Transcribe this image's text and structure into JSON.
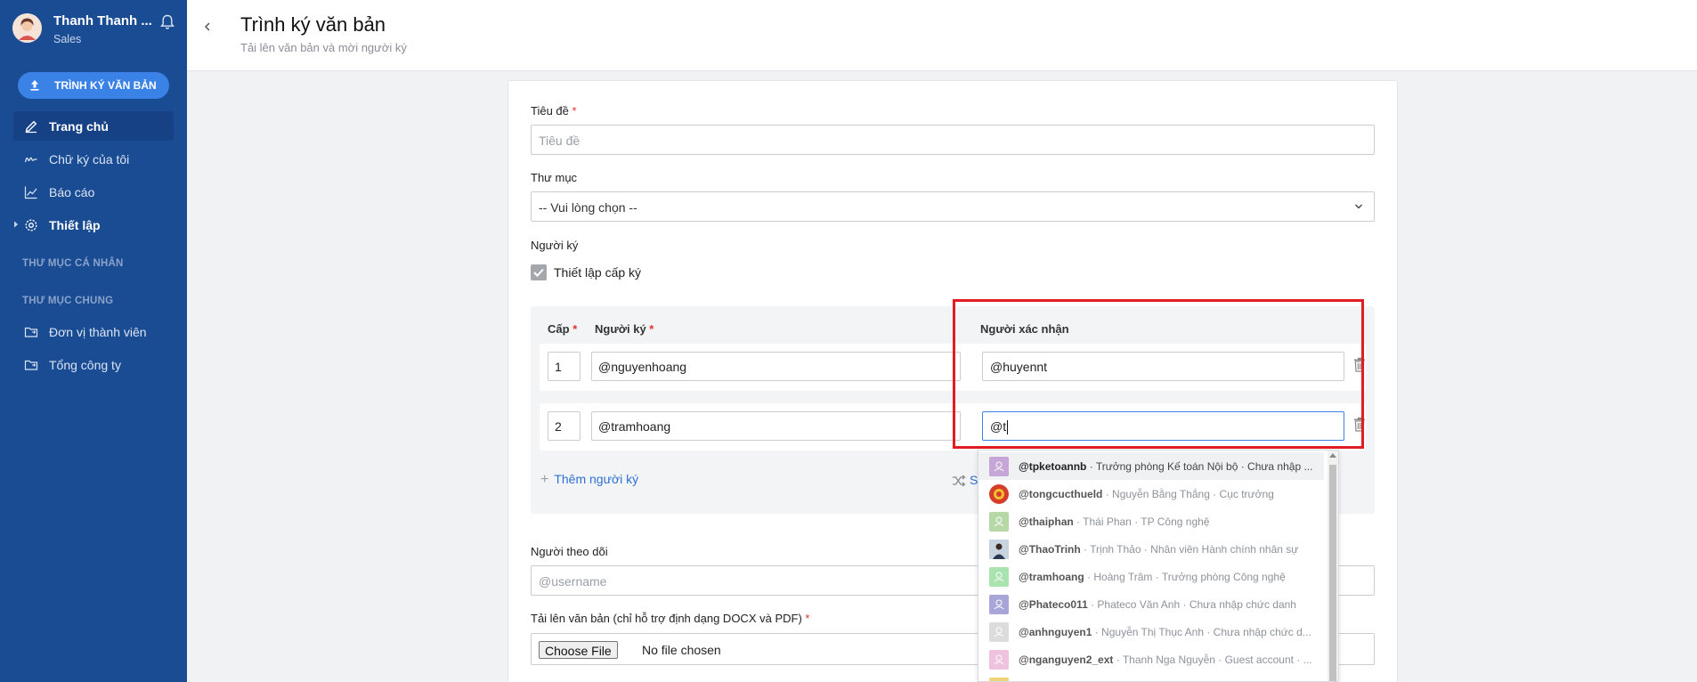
{
  "sidebar": {
    "user_name": "Thanh Thanh ...",
    "user_role": "Sales",
    "primary_button": "TRÌNH KÝ VĂN BẢN",
    "nav": [
      {
        "label": "Trang chủ",
        "icon": "pen-icon",
        "active": true
      },
      {
        "label": "Chữ ký của tôi",
        "icon": "signature-icon",
        "active": false
      },
      {
        "label": "Báo cáo",
        "icon": "chart-line-icon",
        "active": false
      },
      {
        "label": "Thiết lập",
        "icon": "gear-icon",
        "active": false
      }
    ],
    "section_personal": "THƯ MỤC CÁ NHÂN",
    "section_shared": "THƯ MỤC CHUNG",
    "folders": [
      {
        "label": "Đơn vị thành viên",
        "icon": "folder-icon"
      },
      {
        "label": "Tổng công ty",
        "icon": "folder-icon"
      }
    ]
  },
  "header": {
    "title": "Trình ký văn bản",
    "subtitle": "Tải lên văn bản và mời người ký"
  },
  "form": {
    "title_label": "Tiêu đề",
    "title_placeholder": "Tiêu đề",
    "folder_label": "Thư mục",
    "folder_value": "-- Vui lòng chọn --",
    "signers_label": "Người ký",
    "setup_levels_label": "Thiết lập cấp ký",
    "setup_levels_checked": true,
    "col_level": "Cấp",
    "col_signer": "Người ký",
    "col_confirmer": "Người xác nhận",
    "rows": [
      {
        "level": "1",
        "signer": "@nguyenhoang",
        "confirmer": "@huyennt"
      },
      {
        "level": "2",
        "signer": "@tramhoang",
        "confirmer": "@t"
      }
    ],
    "add_signer": "Thêm người ký",
    "shuffle_label": "S",
    "followers_label": "Người theo dõi",
    "followers_placeholder": "@username",
    "upload_label": "Tải lên văn bản (chỉ hỗ trợ định dạng DOCX và PDF)",
    "choose_file": "Choose File",
    "no_file": "No file chosen",
    "required_mark": "*"
  },
  "dropdown": [
    {
      "user": "@tpketoannb",
      "desc": " · Trưởng phòng Kế toán Nội bộ · Chưa nhập ...",
      "avatar_color": "#c6a6d6",
      "highlighted": true
    },
    {
      "user": "@tongcucthueld",
      "desc": " · Nguyễn Bằng Thắng · Cục trưởng",
      "avatar_color": "#d63c2a",
      "highlighted": false
    },
    {
      "user": "@thaiphan",
      "desc": " · Thái Phan · TP Công nghệ",
      "avatar_color": "#b5d8a6",
      "highlighted": false
    },
    {
      "user": "@ThaoTrinh",
      "desc": " · Trịnh Thảo · Nhân viên Hành chính nhân sự",
      "avatar_color": "#4a5f7a",
      "highlighted": false
    },
    {
      "user": "@tramhoang",
      "desc": " · Hoàng Trâm · Trưởng phòng Công nghệ",
      "avatar_color": "#a9e3b0",
      "highlighted": false
    },
    {
      "user": "@Phateco011",
      "desc": " · Phateco Văn Anh · Chưa nhập chức danh",
      "avatar_color": "#a8a6d8",
      "highlighted": false
    },
    {
      "user": "@anhnguyen1",
      "desc": " · Nguyễn Thị Thục Anh · Chưa nhập chức d...",
      "avatar_color": "#dcdcdc",
      "highlighted": false
    },
    {
      "user": "@nganguyen2_ext",
      "desc": " · Thanh Nga Nguyễn · Guest account · ...",
      "avatar_color": "#efc3df",
      "highlighted": false
    },
    {
      "user": "",
      "desc": "",
      "avatar_color": "#f0d27a",
      "highlighted": false
    }
  ]
}
